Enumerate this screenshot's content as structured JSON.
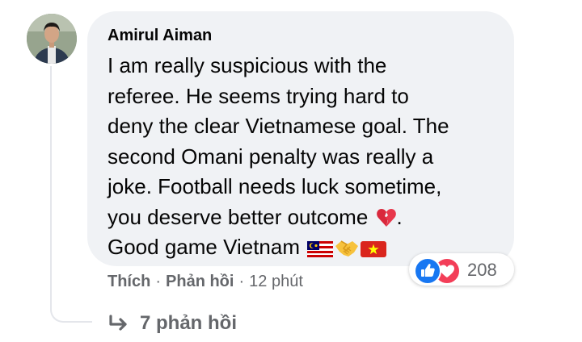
{
  "comment": {
    "author": "Amirul Aiman",
    "lines": [
      "I am really suspicious with the",
      "referee. He seems trying hard to",
      "deny the clear Vietnamese goal. The",
      "second Omani penalty was really a",
      "joke. Football needs luck sometime,",
      "you deserve better outcome",
      "Good game Vietnam"
    ],
    "line6_suffix": ".",
    "emojis": [
      "broken-heart-icon",
      "malaysia-flag-icon",
      "handshake-icon",
      "vietnam-flag-icon"
    ]
  },
  "reactions": {
    "icons": [
      "like-icon",
      "love-icon"
    ],
    "count": "208",
    "colors": {
      "like": "#1877f2",
      "love": "#f33e58"
    }
  },
  "actions": {
    "like": "Thích",
    "separator": "·",
    "reply": "Phản hồi",
    "time": "12 phút"
  },
  "replies": {
    "label": "7 phản hồi"
  },
  "colors": {
    "bubble": "#f0f2f5",
    "text": "#050505",
    "secondary": "#65676b"
  }
}
